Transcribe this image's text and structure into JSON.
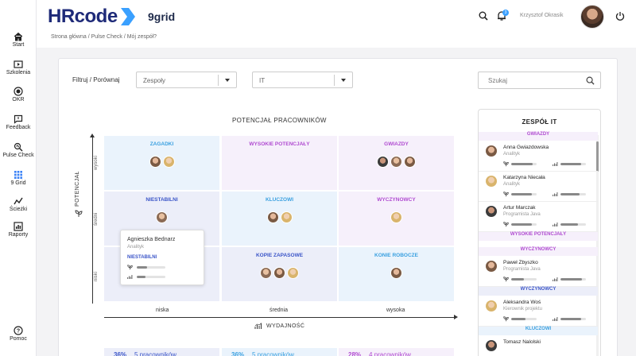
{
  "sidebar": {
    "items": [
      {
        "label": "Start",
        "icon": "home-icon"
      },
      {
        "label": "Szkolenia",
        "icon": "play-icon"
      },
      {
        "label": "OKR",
        "icon": "target-icon"
      },
      {
        "label": "Feedback",
        "icon": "chat-icon"
      },
      {
        "label": "Pulse Check",
        "icon": "search-pulse-icon"
      },
      {
        "label": "9 Grid",
        "icon": "grid-icon"
      },
      {
        "label": "Ścieżki",
        "icon": "path-icon"
      },
      {
        "label": "Raporty",
        "icon": "chart-icon"
      }
    ],
    "help": {
      "label": "Pomoc",
      "icon": "help-icon"
    },
    "active_color": "#3b82f6"
  },
  "header": {
    "logo": "HRcode",
    "app_name": "9grid",
    "breadcrumb": "Strona główna  /  Pulse Check / Mój zespół?",
    "notifications": "3",
    "user_name": "Krzysztof Okrasik",
    "brand_color": "#1e2a78",
    "accent_color": "#3aa0ff"
  },
  "filters": {
    "label": "Filtruj / Porównaj",
    "select1": "Zespoły",
    "select2": "IT",
    "search_placeholder": "Szukaj"
  },
  "grid": {
    "title": "POTENCJAŁ PRACOWNIKÓW",
    "y_label": "POTENCJAŁ",
    "x_label": "WYDAJNOŚĆ",
    "y_levels": [
      "wysoki",
      "średni",
      "niski"
    ],
    "x_levels": [
      "niska",
      "średnia",
      "wysoka"
    ],
    "cells": [
      {
        "title": "ZAGADKI",
        "color": "#3aa0e0",
        "bg": "#eaf3fc",
        "avatars": 2
      },
      {
        "title": "WYSOKIE POTENCJAŁY",
        "color": "#b04bd1",
        "bg": "#f6f0fb",
        "avatars": 0
      },
      {
        "title": "GWIAZDY",
        "color": "#b04bd1",
        "bg": "#f6f0fb",
        "avatars": 3
      },
      {
        "title": "NIESTABILNI",
        "color": "#3b55c8",
        "bg": "#eceef9",
        "avatars": 1
      },
      {
        "title": "KLUCZOWI",
        "color": "#3aa0e0",
        "bg": "#eaf3fc",
        "avatars": 2
      },
      {
        "title": "WYCZYNOWCY",
        "color": "#b04bd1",
        "bg": "#f6f0fb",
        "avatars": 1
      },
      {
        "title": "",
        "color": "#3b55c8",
        "bg": "#eceef9",
        "avatars": 0
      },
      {
        "title": "KOPIE ZAPASOWE",
        "color": "#3b55c8",
        "bg": "#eceef9",
        "avatars": 3
      },
      {
        "title": "KONIE ROBOCZE",
        "color": "#3aa0e0",
        "bg": "#eaf3fc",
        "avatars": 1
      }
    ],
    "tooltip": {
      "name": "Agnieszka Bednarz",
      "role": "Analityk",
      "tag": "NIESTABILNI",
      "potential": 0.35,
      "performance": 0.3
    },
    "stats": [
      {
        "pct": "36%",
        "count": "5 pracowników",
        "color": "#3b55c8",
        "bg": "#eceef9"
      },
      {
        "pct": "36%",
        "count": "5 pracowników",
        "color": "#3aa0e0",
        "bg": "#eaf3fc"
      },
      {
        "pct": "28%",
        "count": "4 pracowników",
        "color": "#b04bd1",
        "bg": "#f6f0fb"
      }
    ]
  },
  "team": {
    "title": "ZESPÓŁ IT",
    "groups": [
      {
        "label": "GWIAZDY",
        "color": "#b04bd1",
        "bg": "#f6f0fb",
        "members": [
          {
            "name": "Anna Gwiazdowska",
            "role": "Analityk",
            "potential": 0.85,
            "performance": 0.8
          },
          {
            "name": "Katarzyna Niecała",
            "role": "Analityk",
            "potential": 0.8,
            "performance": 0.75
          },
          {
            "name": "Artur Marczak",
            "role": "Programista Java",
            "potential": 0.82,
            "performance": 0.7
          }
        ]
      },
      {
        "label": "WYSOKIE POTENCJAŁY",
        "color": "#b04bd1",
        "bg": "#f6f0fb",
        "members": []
      },
      {
        "label": "WYCZYNOWCY",
        "color": "#b04bd1",
        "bg": "#f6f0fb",
        "members": [
          {
            "name": "Paweł Zbyszko",
            "role": "Programista Java",
            "potential": 0.5,
            "performance": 0.85
          }
        ]
      },
      {
        "label": "WYCZYNOWCY",
        "color": "#3b55c8",
        "bg": "#eceef9",
        "members": [
          {
            "name": "Aleksandra Woś",
            "role": "Kierownik projektu",
            "potential": 0.55,
            "performance": 0.8
          }
        ]
      },
      {
        "label": "KLUCZOWI",
        "color": "#3aa0e0",
        "bg": "#eaf3fc",
        "members": [
          {
            "name": "Tomasz Nalolski",
            "role": "",
            "potential": 0.5,
            "performance": 0.5
          }
        ]
      }
    ]
  }
}
